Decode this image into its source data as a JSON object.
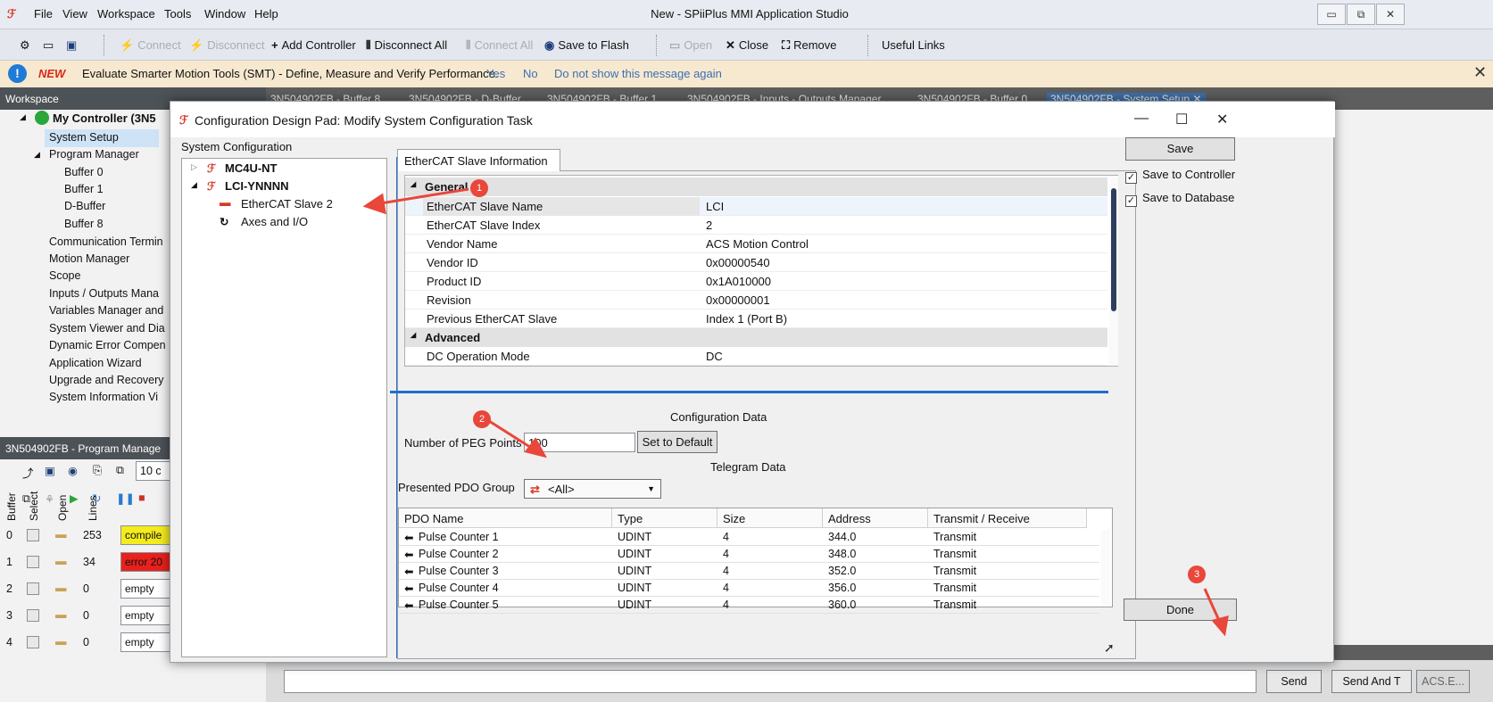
{
  "app": {
    "title": "New - SPiiPlus MMI Application Studio",
    "menu": [
      "File",
      "View",
      "Workspace",
      "Tools",
      "Window",
      "Help"
    ],
    "window_buttons": [
      "▭",
      "⧉",
      "✕"
    ]
  },
  "toolbar": {
    "connect": "Connect",
    "disconnect": "Disconnect",
    "add_controller": "Add Controller",
    "disconnect_all": "Disconnect All",
    "connect_all": "Connect All",
    "save_to_flash": "Save to Flash",
    "open": "Open",
    "close": "Close",
    "remove": "Remove",
    "useful_links": "Useful Links"
  },
  "banner": {
    "new": "NEW",
    "message": "Evaluate Smarter Motion Tools (SMT) - Define, Measure and Verify Performance.",
    "yes": "Yes",
    "no": "No",
    "dont_show": "Do not show this message again"
  },
  "workspace": {
    "header": "Workspace",
    "root": "My Controller (3N5",
    "items": [
      "System Setup",
      "Program Manager",
      "Buffer 0",
      "Buffer 1",
      "D-Buffer",
      "Buffer 8",
      "Communication Termin",
      "Motion Manager",
      "Scope",
      "Inputs / Outputs Mana",
      "Variables Manager and",
      "System Viewer and Dia",
      "Dynamic Error Compen",
      "Application Wizard",
      "Upgrade and Recovery",
      "System Information Vi"
    ]
  },
  "program_manager": {
    "header": "3N504902FB - Program Manage",
    "lines_field": "10 c",
    "columns": [
      "Buffer",
      "Select",
      "Open",
      "Lines"
    ],
    "rows": [
      {
        "buffer": "0",
        "lines": "253",
        "status": "compile",
        "color": "#f4ec1c"
      },
      {
        "buffer": "1",
        "lines": "34",
        "status": "error 20",
        "color": "#e8211c"
      },
      {
        "buffer": "2",
        "lines": "0",
        "status": "empty",
        "color": "#ffffff"
      },
      {
        "buffer": "3",
        "lines": "0",
        "status": "empty",
        "color": "#ffffff"
      },
      {
        "buffer": "4",
        "lines": "0",
        "status": "empty",
        "color": "#ffffff"
      }
    ]
  },
  "doc_tabs": [
    "3N504902FB - Buffer 8",
    "3N504902FB - D-Buffer",
    "3N504902FB - Buffer 1",
    "3N504902FB - Inputs - Outputs Manager",
    "3N504902FB - Buffer 0",
    "3N504902FB - System Setup"
  ],
  "bottom": {
    "send": "Send",
    "send_and": "Send And T",
    "acs": "ACS.E..."
  },
  "dialog": {
    "title": "Configuration Design Pad: Modify System Configuration Task",
    "system_configuration": "System Configuration",
    "tree": {
      "node1": "MC4U-NT",
      "node2": "LCI-YNNNN",
      "child1": "EtherCAT Slave 2",
      "child2": "Axes and I/O"
    },
    "info_tab": "EtherCAT Slave Information",
    "general": "General",
    "advanced": "Advanced",
    "props": [
      {
        "name": "EtherCAT Slave Name",
        "value": "LCI"
      },
      {
        "name": "EtherCAT Slave Index",
        "value": "2"
      },
      {
        "name": "Vendor Name",
        "value": "ACS Motion Control"
      },
      {
        "name": "Vendor ID",
        "value": "0x00000540"
      },
      {
        "name": "Product ID",
        "value": "0x1A010000"
      },
      {
        "name": "Revision",
        "value": "0x00000001"
      },
      {
        "name": "Previous EtherCAT Slave",
        "value": "Index 1 (Port B)"
      }
    ],
    "adv_props": [
      {
        "name": "DC Operation Mode",
        "value": "DC"
      }
    ],
    "configuration_data": "Configuration Data",
    "peg_label": "Number of PEG Points",
    "peg_value": "100",
    "set_default": "Set to Default",
    "telegram_data": "Telegram Data",
    "pdo_group_label": "Presented PDO Group",
    "pdo_group_value": "<All>",
    "table_columns": [
      "PDO Name",
      "Type",
      "Size",
      "Address",
      "Transmit / Receive"
    ],
    "table_rows": [
      [
        "Pulse Counter 1",
        "UDINT",
        "4",
        "344.0",
        "Transmit"
      ],
      [
        "Pulse Counter 2",
        "UDINT",
        "4",
        "348.0",
        "Transmit"
      ],
      [
        "Pulse Counter 3",
        "UDINT",
        "4",
        "352.0",
        "Transmit"
      ],
      [
        "Pulse Counter 4",
        "UDINT",
        "4",
        "356.0",
        "Transmit"
      ],
      [
        "Pulse Counter 5",
        "UDINT",
        "4",
        "360.0",
        "Transmit"
      ]
    ],
    "save": "Save",
    "save_to_controller": "Save to Controller",
    "save_to_database": "Save to Database",
    "done": "Done"
  },
  "callouts": [
    "1",
    "2",
    "3"
  ],
  "colors": {
    "accent": "#1f6fd1",
    "callout": "#e8473a",
    "banner": "#f7e9cf"
  }
}
